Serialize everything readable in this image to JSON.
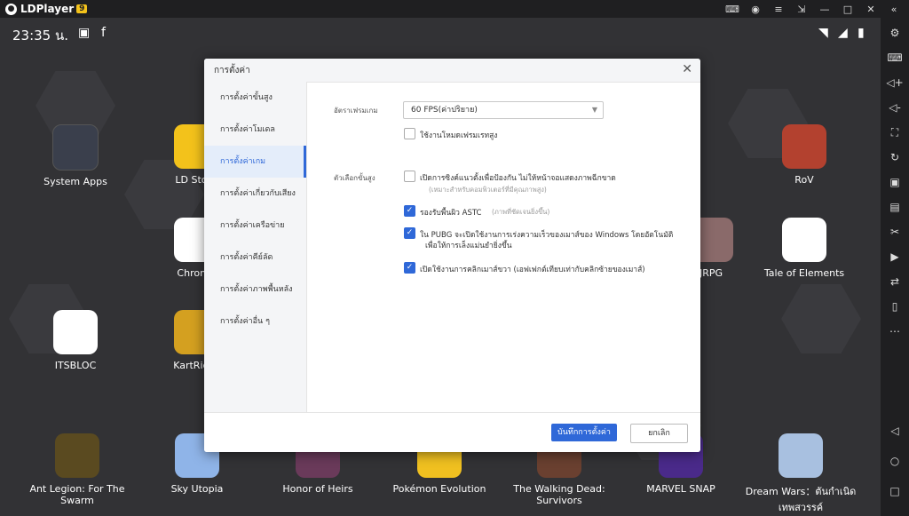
{
  "titlebar": {
    "app_name": "LDPlayer",
    "version": "9",
    "icons": [
      "gamepad-icon",
      "account-icon",
      "menu-icon",
      "external-icon",
      "minimize-icon",
      "maximize-icon",
      "close-icon",
      "collapse-icon"
    ]
  },
  "status": {
    "time": "23:35 น."
  },
  "apps": [
    {
      "label": "System Apps"
    },
    {
      "label": "LD Store"
    },
    {
      "label": "RoV"
    },
    {
      "label": "Chrome"
    },
    {
      "label": "JRPG"
    },
    {
      "label": "Tale of Elements"
    },
    {
      "label": "ITSBLOC"
    },
    {
      "label": "KartRider"
    },
    {
      "label": "Ant Legion: For The Swarm"
    },
    {
      "label": "Sky Utopia"
    },
    {
      "label": "Honor of Heirs"
    },
    {
      "label": "Pokémon Evolution"
    },
    {
      "label": "The Walking Dead: Survivors"
    },
    {
      "label": "MARVEL SNAP"
    },
    {
      "label": "Dream Wars：ตันกำเนิดเทพสวรรค์"
    }
  ],
  "modal": {
    "title": "การตั้งค่า",
    "nav": [
      "การตั้งค่าขั้นสูง",
      "การตั้งค่าโมเดล",
      "การตั้งค่าเกม",
      "การตั้งค่าเกี่ยวกับเสียง",
      "การตั้งค่าเครือข่าย",
      "การตั้งค่าคีย์ลัด",
      "การตั้งค่าภาพพื้นหลัง",
      "การตั้งค่าอื่น ๆ"
    ],
    "active_nav": 2,
    "fps_label": "อัตราเฟรมเกม",
    "fps_value": "60 FPS(ค่าปริยาย)",
    "high_fps": "ใช้งานโหมดเฟรมเรทสูง",
    "advanced_label": "ตัวเลือกขั้นสูง",
    "opt1": "เปิดการซิงค์แนวตั้งเพื่อป้องกัน ไม่ให้หน้าจอแสดงภาพฉีกขาด",
    "opt1_sub": "(เหมาะสำหรับคอมพิวเตอร์ที่มีคุณภาพสูง)",
    "opt2": "รองรับพื้นผิว ASTC",
    "opt2_sub": "(ภาพที่ชัดเจนยิ่งขึ้น)",
    "opt3_a": "ใน PUBG จะเปิดใช้งานการเร่งความเร็วของเมาส์ของ Windows โดยอัตโนมัติ",
    "opt3_b": "เพื่อให้การเล็งแม่นยำยิ่งขึ้น",
    "opt4": "เปิดใช้งานการคลิกเมาส์ขวา (เอฟเฟกต์เทียบเท่ากับคลิกซ้ายของเมาส์)",
    "save": "บันทึกการตั้งค่า",
    "cancel": "ยกเลิก"
  }
}
